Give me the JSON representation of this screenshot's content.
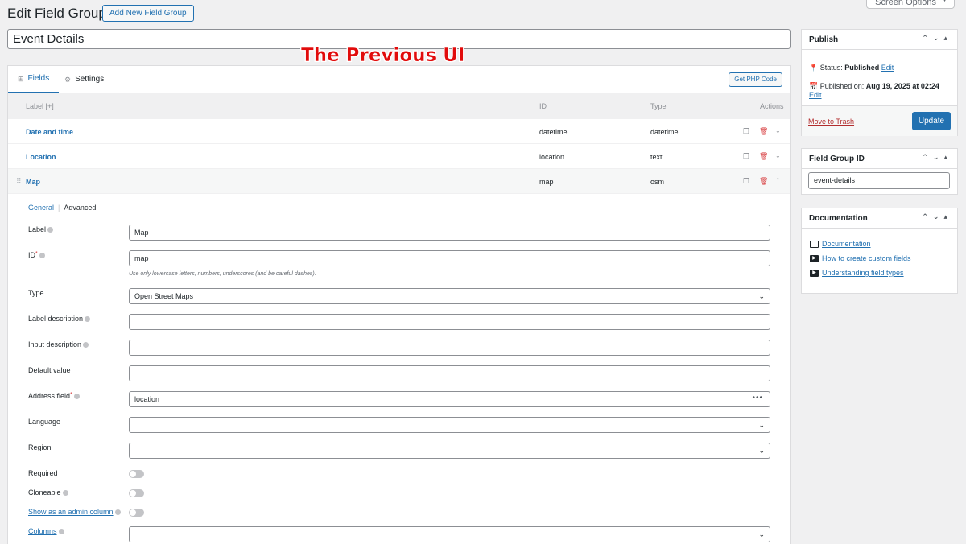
{
  "screen_options": {
    "label": "Screen Options"
  },
  "header": {
    "title": "Edit Field Group",
    "add_new_label": "Add New Field Group",
    "group_title_value": "Event Details",
    "overlay_caption": "The Previous UI"
  },
  "tabs": [
    {
      "label": "Fields",
      "icon": "grid-icon"
    },
    {
      "label": "Settings",
      "icon": "gear-icon"
    }
  ],
  "get_php_label": "Get PHP Code",
  "table": {
    "headers": {
      "label": "Label",
      "label_suffix": "[+]",
      "id": "ID",
      "type": "Type",
      "actions": "Actions"
    },
    "rows": [
      {
        "label": "Date and time",
        "id": "datetime",
        "type": "datetime"
      },
      {
        "label": "Location",
        "id": "location",
        "type": "text"
      },
      {
        "label": "Map",
        "id": "map",
        "type": "osm"
      }
    ]
  },
  "field_editor": {
    "subtabs": {
      "general": "General",
      "advanced": "Advanced"
    },
    "label": {
      "title": "Label",
      "value": "Map"
    },
    "id": {
      "title": "ID",
      "required_mark": "*",
      "value": "map",
      "hint": "Use only lowercase letters, numbers, underscores (and be careful dashes)."
    },
    "type": {
      "title": "Type",
      "value": "Open Street Maps"
    },
    "label_description": {
      "title": "Label description"
    },
    "input_description": {
      "title": "Input description"
    },
    "default_value": {
      "title": "Default value"
    },
    "address_field": {
      "title": "Address field",
      "required_mark": "*",
      "value": "location"
    },
    "language": {
      "title": "Language"
    },
    "region": {
      "title": "Region"
    },
    "required": {
      "title": "Required"
    },
    "cloneable": {
      "title": "Cloneable"
    },
    "admin_column": {
      "title": "Show as an admin column"
    },
    "columns": {
      "title": "Columns"
    }
  },
  "sidebar": {
    "publish": {
      "title": "Publish",
      "status_prefix": "Status:",
      "status_value": "Published",
      "edit_label": "Edit",
      "published_prefix": "Published on:",
      "published_value": "Aug 19, 2025 at 02:24",
      "trash_label": "Move to Trash",
      "update_label": "Update"
    },
    "field_group_id": {
      "title": "Field Group ID",
      "value": "event-details"
    },
    "documentation": {
      "title": "Documentation",
      "links": [
        {
          "label": "Documentation",
          "icon": "document-icon"
        },
        {
          "label": "How to create custom fields",
          "icon": "video-icon"
        },
        {
          "label": "Understanding field types",
          "icon": "video-icon"
        }
      ]
    }
  }
}
